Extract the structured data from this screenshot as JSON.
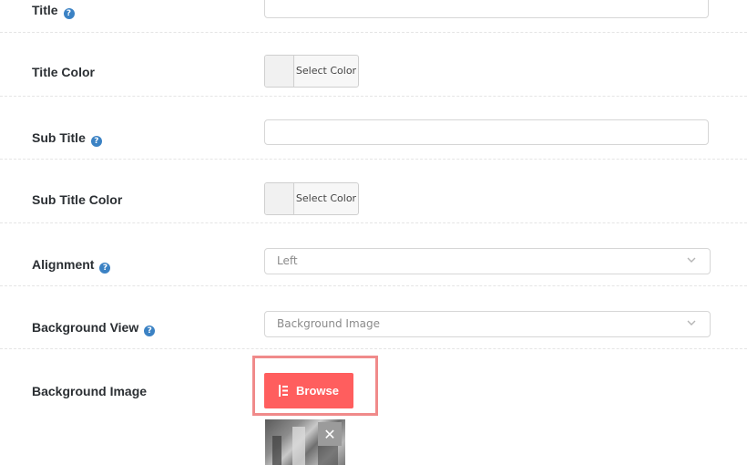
{
  "fields": {
    "title": {
      "label": "Title",
      "has_help": true,
      "value": ""
    },
    "title_color": {
      "label": "Title Color",
      "button_label": "Select Color"
    },
    "sub_title": {
      "label": "Sub Title",
      "has_help": true,
      "value": ""
    },
    "sub_title_color": {
      "label": "Sub Title Color",
      "button_label": "Select Color"
    },
    "alignment": {
      "label": "Alignment",
      "has_help": true,
      "selected": "Left"
    },
    "background_view": {
      "label": "Background View",
      "has_help": true,
      "selected": "Background Image"
    },
    "background_image": {
      "label": "Background Image",
      "browse_label": "Browse",
      "remove_label": "✕"
    }
  },
  "help_glyph": "?",
  "colors": {
    "accent": "#ff5e5e",
    "highlight_border": "#f08a8a",
    "help_icon": "#3b82c4"
  },
  "icons": {
    "help": "question-circle-icon",
    "chevron": "chevron-down-icon",
    "browse": "list-icon",
    "remove": "close-icon"
  }
}
